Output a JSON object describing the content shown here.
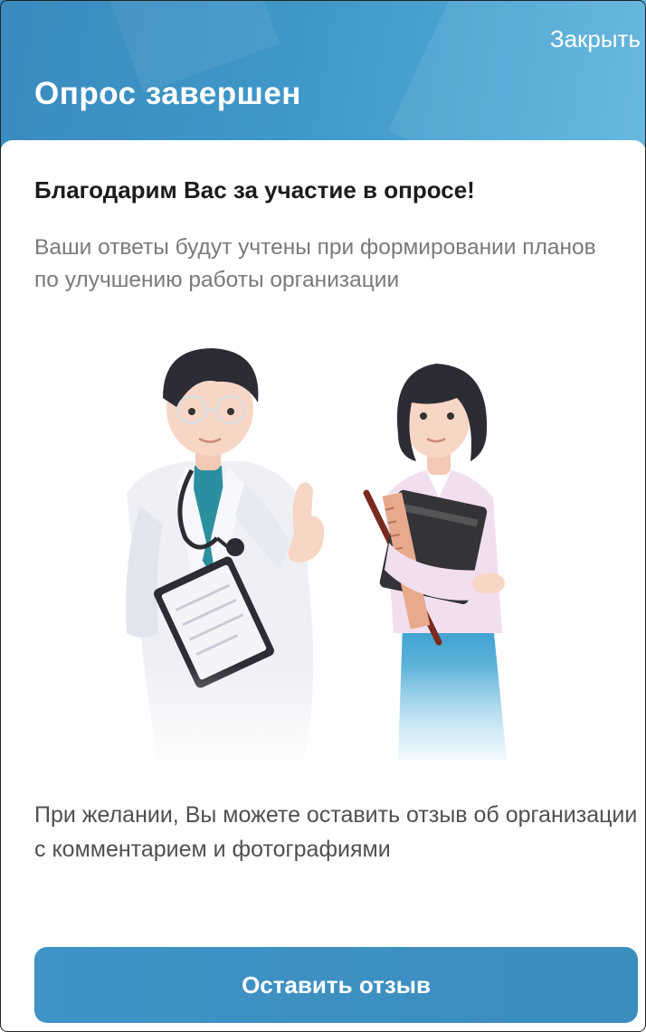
{
  "header": {
    "close_label": "Закрыть",
    "title": "Опрос завершен"
  },
  "content": {
    "thanks": "Благодарим Вас за участие в опросе!",
    "subtitle": "Ваши ответы будут учтены при формировании планов по улучшению работы организации",
    "illustration": "doctor-and-woman-illustration",
    "feedback_text": "При желании, Вы можете оставить отзыв об организации с комментарием и фотографиями"
  },
  "actions": {
    "leave_feedback_label": "Оставить отзыв"
  },
  "colors": {
    "header": "#3f97c8",
    "button": "#3f93c6",
    "title_text": "#1c1c1c",
    "subtitle_text": "#7a7a7a"
  }
}
